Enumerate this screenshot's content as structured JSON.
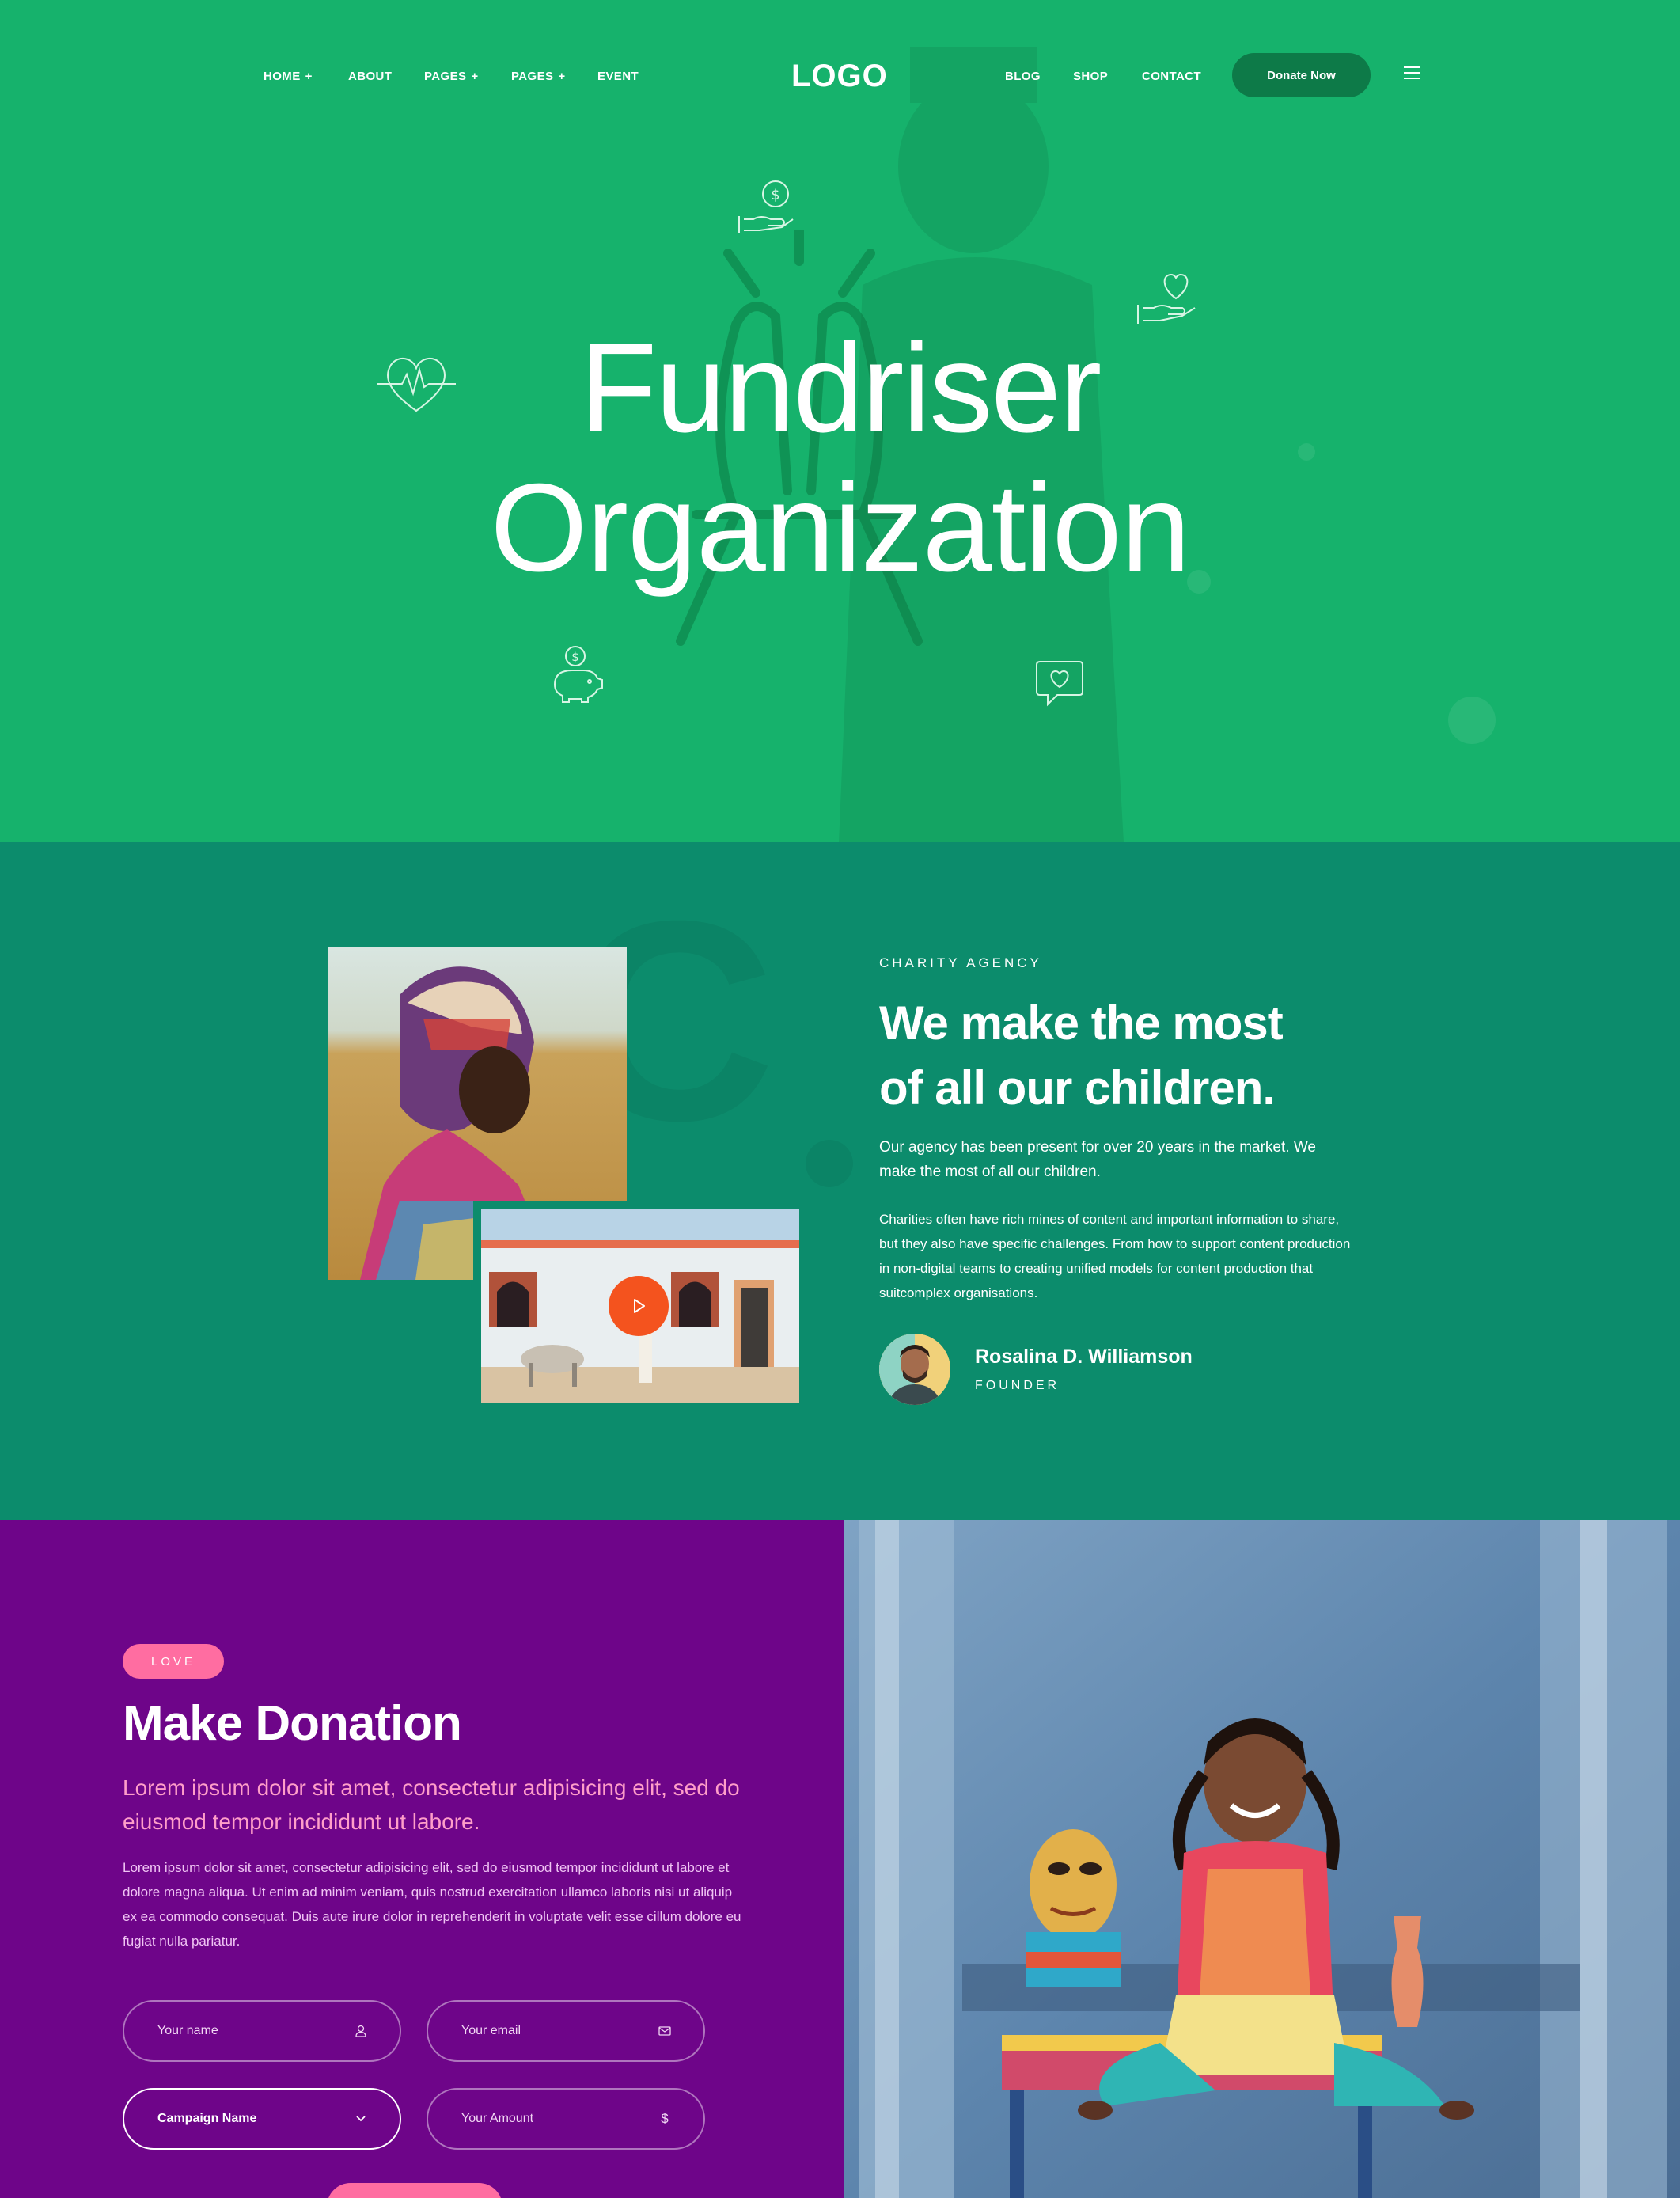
{
  "colors": {
    "hero_green": "#16b26c",
    "about_teal": "#0c8c6c",
    "donation_purple": "#6e0589",
    "accent_pink": "#ff6da1",
    "play_orange": "#f4531e",
    "donate_button": "#0d7a48"
  },
  "nav": {
    "left_items": [
      {
        "label": "HOME",
        "has_submenu": true
      },
      {
        "label": "ABOUT",
        "has_submenu": false
      },
      {
        "label": "PAGES",
        "has_submenu": true
      },
      {
        "label": "PAGES",
        "has_submenu": true
      },
      {
        "label": "EVENT",
        "has_submenu": false
      }
    ],
    "submenu_symbol": "+",
    "logo": "LOGO",
    "right_items": [
      {
        "label": "BLOG"
      },
      {
        "label": "SHOP"
      },
      {
        "label": "CONTACT"
      }
    ],
    "donate_label": "Donate Now",
    "menu_icon": "hamburger-icon"
  },
  "hero": {
    "title_light": "Fundriser",
    "title_bold": "Organization",
    "icons": [
      "hand-money-icon",
      "hand-heart-icon",
      "heartbeat-icon",
      "piggy-bank-icon",
      "heart-chat-icon",
      "praying-hands-icon"
    ]
  },
  "about": {
    "eyebrow": "CHARITY AGENCY",
    "title_line1": "We make the most",
    "title_line2": "of all our children.",
    "paragraph1": "Our agency has been present for over 20 years in the market. We make the most of all our children.",
    "paragraph2": "Charities often have rich mines of content and important information to share, but they also have specific challenges. From how to support content production in non-digital teams to creating unified models for content production that suitcomplex organisations.",
    "founder_name": "Rosalina D. Williamson",
    "founder_role": "FOUNDER",
    "play_icon": "play-icon"
  },
  "donation": {
    "badge": "LOVE",
    "title": "Make Donation",
    "lead": "Lorem ipsum dolor sit amet, consectetur adipisicing elit, sed do eiusmod tempor incididunt ut labore.",
    "body": "Lorem ipsum dolor sit amet, consectetur adipisicing elit, sed do eiusmod tempor incididunt ut labore et dolore magna aliqua. Ut enim ad minim veniam, quis nostrud exercitation ullamco laboris nisi ut aliquip ex ea commodo consequat. Duis aute irure dolor in reprehenderit in voluptate velit esse cillum dolore eu fugiat nulla pariatur.",
    "fields": {
      "name_placeholder": "Your name",
      "email_placeholder": "Your email",
      "campaign_label": "Campaign Name",
      "amount_placeholder": "Your Amount",
      "amount_symbol": "$"
    }
  }
}
